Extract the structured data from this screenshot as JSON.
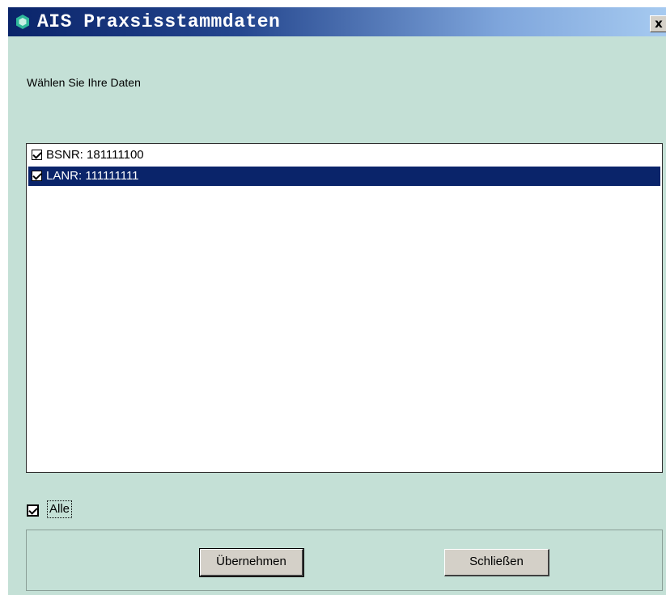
{
  "window": {
    "title": "AIS Praxsisstammdaten",
    "close_label": "x"
  },
  "prompt": "Wählen Sie Ihre Daten",
  "list": {
    "items": [
      {
        "label": "BSNR: 181111100",
        "checked": true,
        "selected": false
      },
      {
        "label": "LANR: 111111111",
        "checked": true,
        "selected": true
      }
    ]
  },
  "select_all": {
    "label": "Alle",
    "checked": true
  },
  "buttons": {
    "apply_label": "Übernehmen",
    "close_label": "Schließen"
  },
  "colors": {
    "background": "#c4e0d6",
    "titlebar_start": "#0a246a",
    "titlebar_end": "#a6caf0",
    "selection": "#0a246a",
    "button_face": "#d4d0c8",
    "icon": "#2fb89a"
  },
  "icons": {
    "app": "hexagon-icon",
    "close": "close-icon",
    "checkbox": "checkbox-checked-icon"
  }
}
